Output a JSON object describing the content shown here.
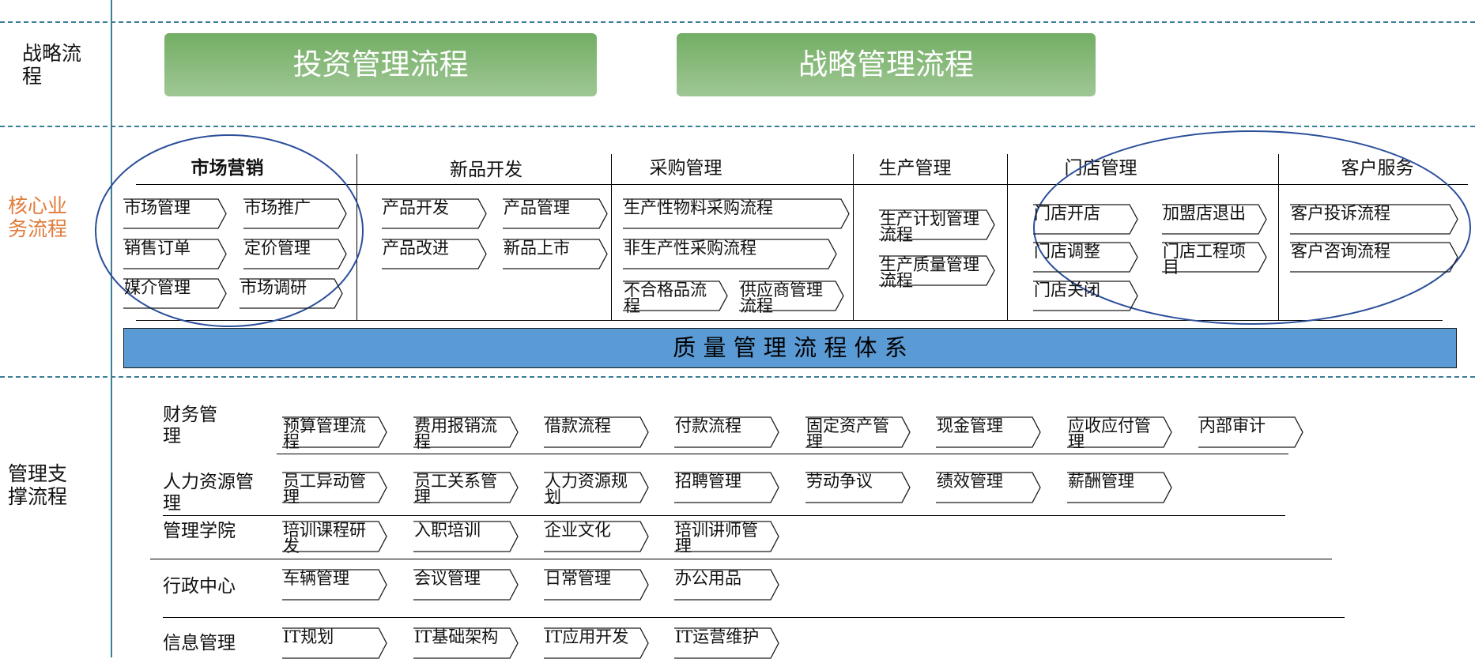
{
  "rows": {
    "strategy": "战略流\n程",
    "core": "核心业\n务流程",
    "support": "管理支\n撑流程"
  },
  "strategy_boxes": [
    "投资管理流程",
    "战略管理流程"
  ],
  "core_sections": [
    "市场营销",
    "新品开发",
    "采购管理",
    "生产管理",
    "门店管理",
    "客户服务"
  ],
  "core_items": {
    "market": [
      "市场管理",
      "市场推广",
      "销售订单",
      "定价管理",
      "媒介管理",
      "市场调研"
    ],
    "newprod": [
      "产品开发",
      "产品管理",
      "产品改进",
      "新品上市"
    ],
    "purchase": [
      "生产性物料采购流程",
      "非生产性采购流程",
      "不合格品流\n程",
      "供应商管理\n流程"
    ],
    "production": [
      "生产计划管理\n流程",
      "生产质量管理\n流程"
    ],
    "store": [
      "门店开店",
      "加盟店退出",
      "门店调整",
      "门店工程项\n目",
      "门店关闭"
    ],
    "service": [
      "客户投诉流程",
      "客户咨询流程"
    ]
  },
  "quality_bar": "质  量  管  理   流  程  体  系",
  "support_groups": [
    {
      "label": "财务管\n理",
      "items": [
        "预算管理流\n程",
        "费用报销流\n程",
        "借款流程",
        "付款流程",
        "固定资产管\n理",
        "现金管理",
        "应收应付管\n理",
        "内部审计"
      ]
    },
    {
      "label": "人力资源管\n理",
      "items": [
        "员工异动管\n理",
        "员工关系管\n理",
        "人力资源规\n划",
        "招聘管理",
        "劳动争议",
        "绩效管理",
        "薪酬管理"
      ]
    },
    {
      "label": "管理学院",
      "items": [
        "培训课程研\n发",
        "入职培训",
        "企业文化",
        "培训讲师管\n理"
      ]
    },
    {
      "label": "行政中心",
      "items": [
        "车辆管理",
        "会议管理",
        "日常管理",
        "办公用品"
      ]
    },
    {
      "label": "信息管理",
      "items": [
        "IT规划",
        "IT基础架构",
        "IT应用开发",
        "IT运营维护"
      ]
    }
  ],
  "colors": {
    "accent_orange": "#e07b39",
    "quality_bar": "#5b9bd5",
    "green_box": "#8bbd7e",
    "divider": "#3a7f96"
  }
}
